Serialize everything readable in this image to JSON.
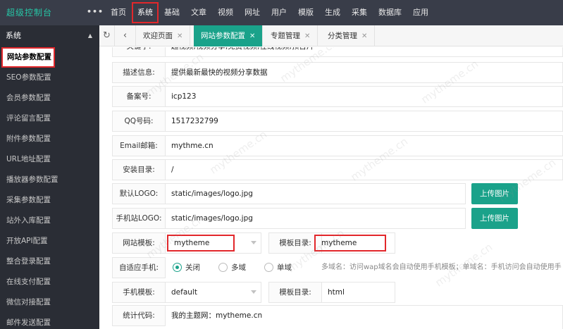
{
  "brand": "超级控制台",
  "more_icon": "more-dots-icon",
  "topnav": [
    "首页",
    "系统",
    "基础",
    "文章",
    "视频",
    "网址",
    "用户",
    "模版",
    "生成",
    "采集",
    "数据库",
    "应用"
  ],
  "sidebar": {
    "section": "系统",
    "items": [
      "网站参数配置",
      "SEO参数配置",
      "会员参数配置",
      "评论留言配置",
      "附件参数配置",
      "URL地址配置",
      "播放器参数配置",
      "采集参数配置",
      "站外入库配置",
      "开放API配置",
      "整合登录配置",
      "在线支付配置",
      "微信对接配置",
      "邮件发送配置"
    ]
  },
  "tabs": [
    "欢迎页面",
    "网站参数配置",
    "专题管理",
    "分类管理"
  ],
  "form": {
    "keywords_label": "关键字:",
    "keywords_value": "超视频,视频分享,免费视频,在线视频,预告片",
    "description_label": "描述信息:",
    "description_value": "提供最新最快的视频分享数据",
    "icp_label": "备案号:",
    "icp_value": "icp123",
    "qq_label": "QQ号码:",
    "qq_value": "1517232799",
    "email_label": "Email邮箱:",
    "email_value": "mythme.cn",
    "install_label": "安装目录:",
    "install_value": "/",
    "logo_label": "默认LOGO:",
    "logo_value": "static/images/logo.jpg",
    "mlogo_label": "手机站LOGO:",
    "mlogo_value": "static/images/logo.jpg",
    "upload_label": "上传图片",
    "template_label": "网站模板:",
    "template_value": "mytheme",
    "template_dir_label": "模板目录:",
    "template_dir_value": "mytheme",
    "mobile_adapt_label": "自适应手机:",
    "radio_close": "关闭",
    "radio_multi": "多域",
    "radio_single": "单域",
    "adapt_hint": "多域名：访问wap域名会自动使用手机模板；单域名：手机访问会自动使用手",
    "mobile_template_label": "手机模板:",
    "mobile_template_value": "default",
    "mobile_template_dir_label": "模板目录:",
    "mobile_template_dir_value": "html",
    "stats_label": "统计代码:",
    "stats_value": "我的主题网：mytheme.cn"
  },
  "watermark": "mytheme.cn",
  "colors": {
    "topbar": "#393d49",
    "sidebar": "#2a2d35",
    "accent": "#1aa28a",
    "highlight": "#e2272b",
    "brand": "#26c6a6"
  }
}
